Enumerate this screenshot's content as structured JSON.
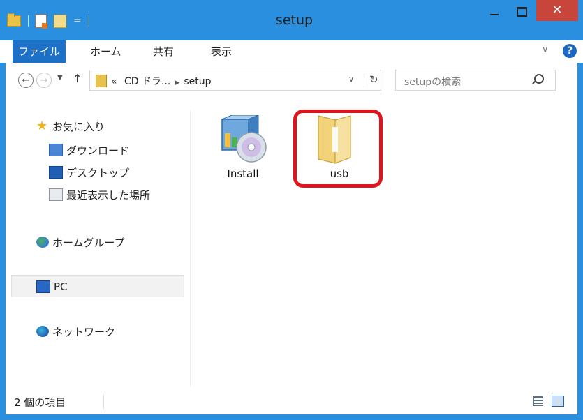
{
  "window": {
    "title": "setup"
  },
  "window_controls": {
    "minimize": "",
    "maximize": "",
    "close": "✕"
  },
  "menu": {
    "file": "ファイル",
    "tabs": [
      "ホーム",
      "共有",
      "表示"
    ],
    "help": "?"
  },
  "address": {
    "overflow": "«",
    "crumbs": [
      "CD ドラ...",
      "setup"
    ]
  },
  "search": {
    "placeholder": "setupの検索"
  },
  "nav": {
    "favorites": "お気に入り",
    "downloads": "ダウンロード",
    "desktop": "デスクトップ",
    "recent": "最近表示した場所",
    "homegroup": "ホームグループ",
    "pc": "PC",
    "network": "ネットワーク"
  },
  "files": [
    {
      "name": "Install",
      "icon": "installer-disc-icon"
    },
    {
      "name": "usb",
      "icon": "folder-icon"
    }
  ],
  "status": {
    "count": "2 個の項目"
  },
  "colors": {
    "titlebar": "#2b8fe0",
    "file_tab": "#1d70c8",
    "close_button": "#c7453a",
    "highlight": "#e0141c"
  }
}
